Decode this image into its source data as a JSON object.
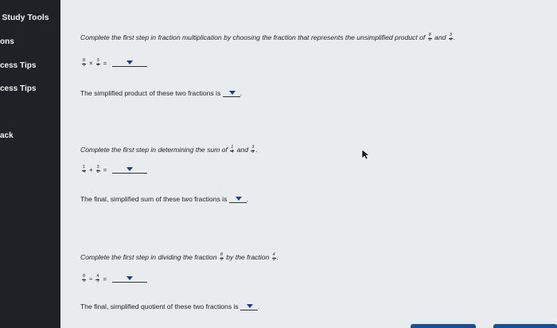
{
  "sidebar": {
    "title": "d Study Tools",
    "items": [
      {
        "label": "ons"
      },
      {
        "label": "cess Tips"
      },
      {
        "label": "cess Tips"
      },
      {
        "label": "ack"
      }
    ]
  },
  "questions": [
    {
      "prompt_pre": "Complete the first step in fraction multiplication by choosing the fraction that represents the unsimplified product of",
      "f1": {
        "num": "8",
        "den": "9"
      },
      "joiner": "and",
      "f2": {
        "num": "3",
        "den": "4"
      },
      "end": ".",
      "expr_a": {
        "num": "8",
        "den": "9"
      },
      "operator": "×",
      "expr_b": {
        "num": "3",
        "den": "4"
      },
      "equals": "=",
      "result_pre": "The simplified product of these two fractions is",
      "result_end": "."
    },
    {
      "prompt_pre": "Complete the first step in determining the sum of",
      "f1": {
        "num": "1",
        "den": "4"
      },
      "joiner": "and",
      "f2": {
        "num": "3",
        "den": "8"
      },
      "end": ".",
      "expr_a": {
        "num": "1",
        "den": "4"
      },
      "operator": "+",
      "expr_b": {
        "num": "3",
        "den": "8"
      },
      "equals": "=",
      "result_pre": "The final, simplified sum of these two fractions is",
      "result_end": "."
    },
    {
      "prompt_pre": "Complete the first step in dividing the fraction",
      "f1": {
        "num": "8",
        "den": "9"
      },
      "joiner": "by the fraction",
      "f2": {
        "num": "4",
        "den": "3"
      },
      "end": ".",
      "expr_a": {
        "num": "8",
        "den": "9"
      },
      "operator": "÷",
      "expr_b": {
        "num": "4",
        "den": "3"
      },
      "equals": "=",
      "result_pre": "The final, simplified quotient of these two fractions is",
      "result_end": "."
    }
  ],
  "icons": {
    "dropdown": "caret-down-icon",
    "cursor": "mouse-pointer-icon"
  },
  "colors": {
    "sidebar_bg": "#1e2125",
    "page_bg": "#e9ecef",
    "accent": "#1a3e8c"
  }
}
